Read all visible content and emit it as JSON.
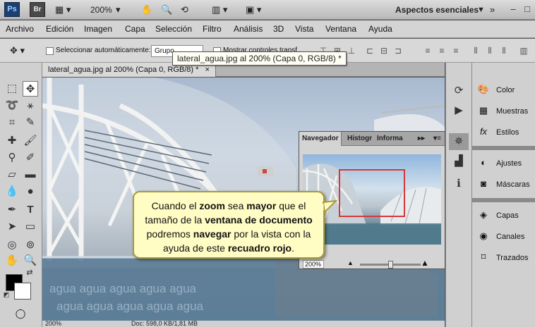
{
  "app": {
    "ps_logo": "Ps",
    "br_logo": "Br",
    "zoom": "200%",
    "workspace": "Aspectos esenciales"
  },
  "menu": [
    "Archivo",
    "Edición",
    "Imagen",
    "Capa",
    "Selección",
    "Filtro",
    "Análisis",
    "3D",
    "Vista",
    "Ventana",
    "Ayuda"
  ],
  "options": {
    "auto_select_label": "Seleccionar automáticamente:",
    "auto_select_value": "Grupo",
    "show_controls_label": "Mostrar controles transf."
  },
  "tooltip": "lateral_agua.jpg al 200% (Capa 0, RGB/8) *",
  "document": {
    "tab": "lateral_agua.jpg al 200% (Capa 0, RGB/8) *",
    "close": "×",
    "watermark": "agua agua agua agua agua"
  },
  "status": {
    "zoom": "200%",
    "doc": "Doc: 598,0 KB/1,81 MB"
  },
  "navigator": {
    "tabs": [
      "Navegador",
      "Histogr",
      "Informa"
    ],
    "zoom": "200%",
    "zoom_level": 0.5
  },
  "callout": {
    "p1": "Cuando el ",
    "b1": "zoom",
    "p2": " sea ",
    "b2": "mayor",
    "p3": " que el tamaño de la ",
    "b3": "ventana de documento",
    "p4": " podremos ",
    "b4": "navegar",
    "p5": " por la vista con la ayuda de este ",
    "b5": "recuadro rojo",
    "p6": "."
  },
  "panels": {
    "top": [
      "Color",
      "Muestras",
      "Estilos"
    ],
    "mid": [
      "Ajustes",
      "Máscaras"
    ],
    "bottom": [
      "Capas",
      "Canales",
      "Trazados"
    ]
  },
  "icons": {
    "colors": {
      "accent_red": "#d23a3a",
      "callout_bg": "#fffcc4"
    }
  }
}
